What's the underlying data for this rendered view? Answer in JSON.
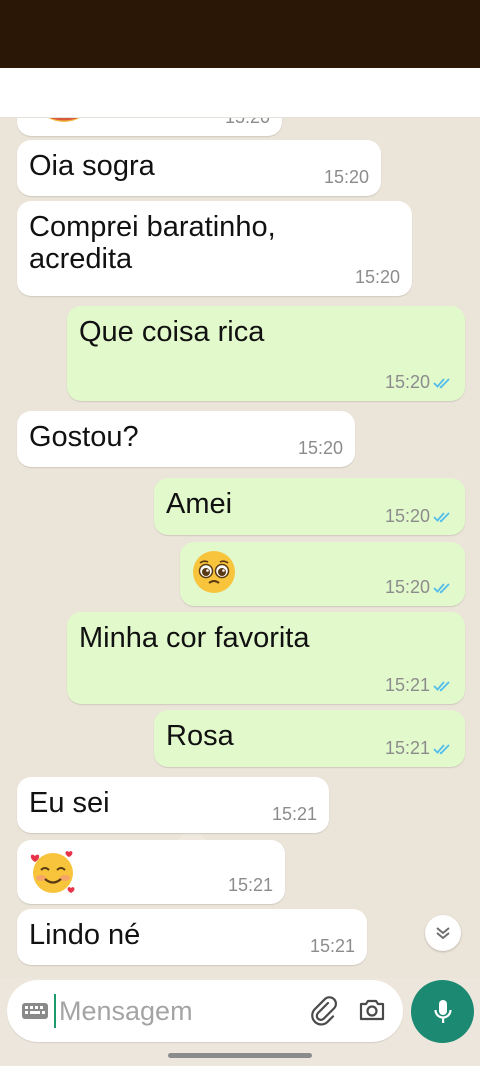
{
  "chat": {
    "messages": [
      {
        "text": "",
        "emoji": "partial",
        "time": "15:20",
        "from": "contact"
      },
      {
        "text": "Oia sogra",
        "time": "15:20",
        "from": "contact"
      },
      {
        "text": "Comprei baratinho,\nacredita",
        "time": "15:20",
        "from": "contact"
      },
      {
        "text": "Que coisa rica",
        "time": "15:20",
        "from": "me",
        "status": "read"
      },
      {
        "text": "Gostou?",
        "time": "15:20",
        "from": "contact"
      },
      {
        "text": "Amei",
        "time": "15:20",
        "from": "me",
        "status": "read"
      },
      {
        "text": "",
        "emoji": "pleading-face",
        "time": "15:20",
        "from": "me",
        "status": "read"
      },
      {
        "text": "Minha cor favorita",
        "time": "15:21",
        "from": "me",
        "status": "read"
      },
      {
        "text": "Rosa",
        "time": "15:21",
        "from": "me",
        "status": "read"
      },
      {
        "text": "Eu sei",
        "time": "15:21",
        "from": "contact"
      },
      {
        "text": "",
        "emoji": "smiling-face-with-hearts",
        "time": "15:21",
        "from": "contact"
      },
      {
        "text": "Lindo né",
        "time": "15:21",
        "from": "contact"
      }
    ]
  },
  "composer": {
    "placeholder": "Mensagem"
  },
  "colors": {
    "outgoing_bubble": "#e2f9cc",
    "incoming_bubble": "#ffffff",
    "read_ticks": "#53bdeb",
    "accent": "#1c8a73"
  },
  "icons": [
    "keyboard-icon",
    "attach-icon",
    "camera-icon",
    "mic-icon",
    "chevron-double-down-icon",
    "read-ticks-icon"
  ]
}
